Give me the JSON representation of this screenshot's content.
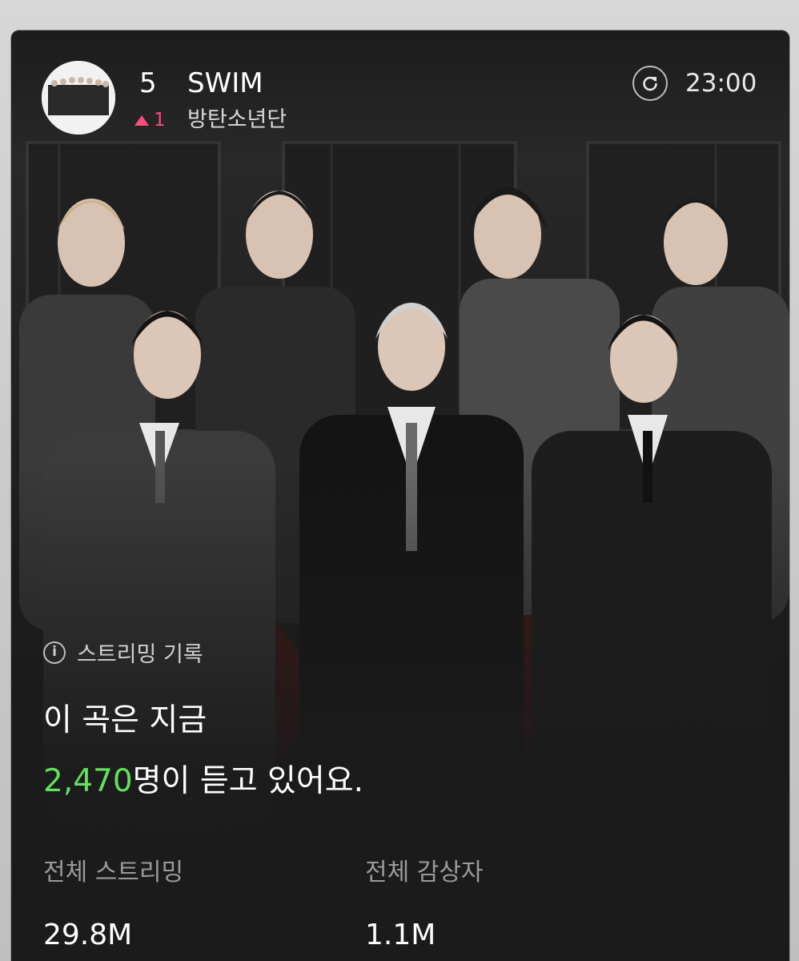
{
  "track": {
    "rank": "5",
    "rank_change": "1",
    "title": "SWIM",
    "artist": "방탄소년단"
  },
  "header": {
    "time": "23:00",
    "refresh_icon": "refresh-icon"
  },
  "streaming": {
    "info_icon": "info-icon",
    "section_label": "스트리밍 기록",
    "headline_line1": "이 곡은 지금",
    "listener_count": "2,470",
    "headline_suffix": "명이 듣고 있어요."
  },
  "stats": [
    {
      "label": "전체 스트리밍",
      "value": "29.8M"
    },
    {
      "label": "전체 감상자",
      "value": "1.1M"
    }
  ],
  "colors": {
    "accent_green": "#61e25a",
    "rank_up_pink": "#ff4b7d",
    "card_background": "#1b1b1b"
  }
}
